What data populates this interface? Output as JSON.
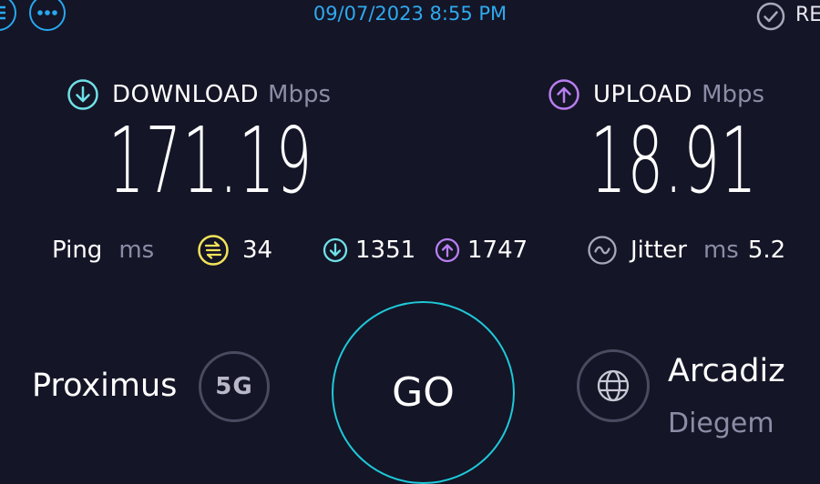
{
  "header": {
    "date": "09/07/2023 8:55 PM",
    "results_label": "RE"
  },
  "download": {
    "label": "DOWNLOAD",
    "unit": "Mbps",
    "value": "171.19",
    "icon": "download-arrow-icon",
    "color": "#6fe0e8"
  },
  "upload": {
    "label": "UPLOAD",
    "unit": "Mbps",
    "value": "18.91",
    "icon": "upload-arrow-icon",
    "color": "#b87ef0"
  },
  "ping": {
    "label": "Ping",
    "unit": "ms",
    "idle_value": "34",
    "idle_color": "#f2e35a",
    "download_value": "1351",
    "upload_value": "1747"
  },
  "jitter": {
    "label": "Jitter",
    "unit": "ms",
    "value": "5.2"
  },
  "provider": {
    "name": "Proximus",
    "network": "5G"
  },
  "go_label": "GO",
  "server": {
    "name": "Arcadiz",
    "city": "Diegem"
  }
}
